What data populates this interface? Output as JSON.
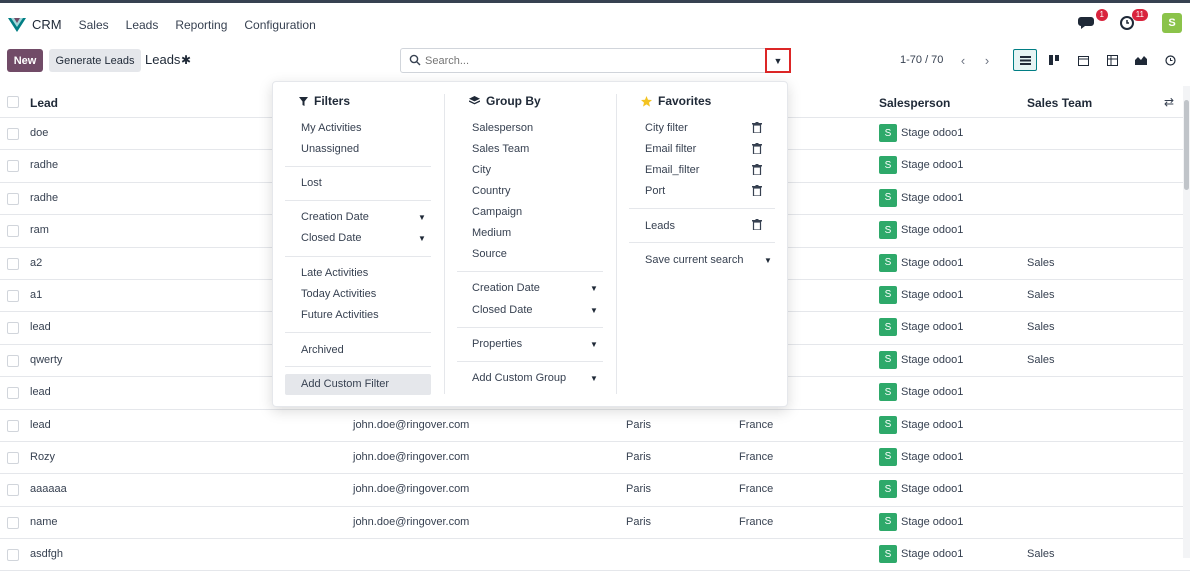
{
  "topbar": {
    "app_name": "CRM",
    "menu": [
      "Sales",
      "Leads",
      "Reporting",
      "Configuration"
    ],
    "messages_badge": "1",
    "activities_badge": "11",
    "avatar_letter": "S"
  },
  "control": {
    "new_label": "New",
    "generate_label": "Generate Leads",
    "breadcrumb": "Leads",
    "search_placeholder": "Search...",
    "pager": "1-70 / 70"
  },
  "table": {
    "headers": {
      "lead": "Lead",
      "salesperson": "Salesperson",
      "team": "Sales Team"
    },
    "rows": [
      {
        "lead": "doe",
        "email": "",
        "city": "",
        "country": "",
        "sp": "Stage odoo1",
        "team": ""
      },
      {
        "lead": "radhe",
        "email": "",
        "city": "",
        "country": "",
        "sp": "Stage odoo1",
        "team": ""
      },
      {
        "lead": "radhe",
        "email": "",
        "city": "",
        "country": "",
        "sp": "Stage odoo1",
        "team": ""
      },
      {
        "lead": "ram",
        "email": "",
        "city": "",
        "country": "",
        "sp": "Stage odoo1",
        "team": ""
      },
      {
        "lead": "a2",
        "email": "",
        "city": "",
        "country": "",
        "sp": "Stage odoo1",
        "team": "Sales"
      },
      {
        "lead": "a1",
        "email": "",
        "city": "",
        "country": "",
        "sp": "Stage odoo1",
        "team": "Sales"
      },
      {
        "lead": "lead",
        "email": "",
        "city": "",
        "country": "",
        "sp": "Stage odoo1",
        "team": "Sales"
      },
      {
        "lead": "qwerty",
        "email": "",
        "city": "",
        "country": "",
        "sp": "Stage odoo1",
        "team": "Sales"
      },
      {
        "lead": "lead",
        "email": "",
        "city": "",
        "country": "",
        "sp": "Stage odoo1",
        "team": ""
      },
      {
        "lead": "lead",
        "email": "john.doe@ringover.com",
        "city": "Paris",
        "country": "France",
        "sp": "Stage odoo1",
        "team": ""
      },
      {
        "lead": "Rozy",
        "email": "john.doe@ringover.com",
        "city": "Paris",
        "country": "France",
        "sp": "Stage odoo1",
        "team": ""
      },
      {
        "lead": "aaaaaa",
        "email": "john.doe@ringover.com",
        "city": "Paris",
        "country": "France",
        "sp": "Stage odoo1",
        "team": ""
      },
      {
        "lead": "name",
        "email": "john.doe@ringover.com",
        "city": "Paris",
        "country": "France",
        "sp": "Stage odoo1",
        "team": ""
      },
      {
        "lead": "asdfgh",
        "email": "",
        "city": "",
        "country": "",
        "sp": "Stage odoo1",
        "team": "Sales"
      }
    ],
    "avatar_letter": "S"
  },
  "dropdown": {
    "filters": {
      "title": "Filters",
      "my_activities": "My Activities",
      "unassigned": "Unassigned",
      "lost": "Lost",
      "creation_date": "Creation Date",
      "closed_date": "Closed Date",
      "late": "Late Activities",
      "today": "Today Activities",
      "future": "Future Activities",
      "archived": "Archived",
      "custom": "Add Custom Filter"
    },
    "groupby": {
      "title": "Group By",
      "salesperson": "Salesperson",
      "sales_team": "Sales Team",
      "city": "City",
      "country": "Country",
      "campaign": "Campaign",
      "medium": "Medium",
      "source": "Source",
      "creation_date": "Creation Date",
      "closed_date": "Closed Date",
      "properties": "Properties",
      "custom": "Add Custom Group"
    },
    "favorites": {
      "title": "Favorites",
      "city_filter": "City filter",
      "email_filter": "Email filter",
      "email_filter2": "Email_filter",
      "port": "Port",
      "leads": "Leads",
      "save": "Save current search"
    }
  },
  "colors": {
    "accent": "#714b67",
    "teal": "#017e84",
    "badge": "#d9243d",
    "avatar": "#2ea96a"
  }
}
